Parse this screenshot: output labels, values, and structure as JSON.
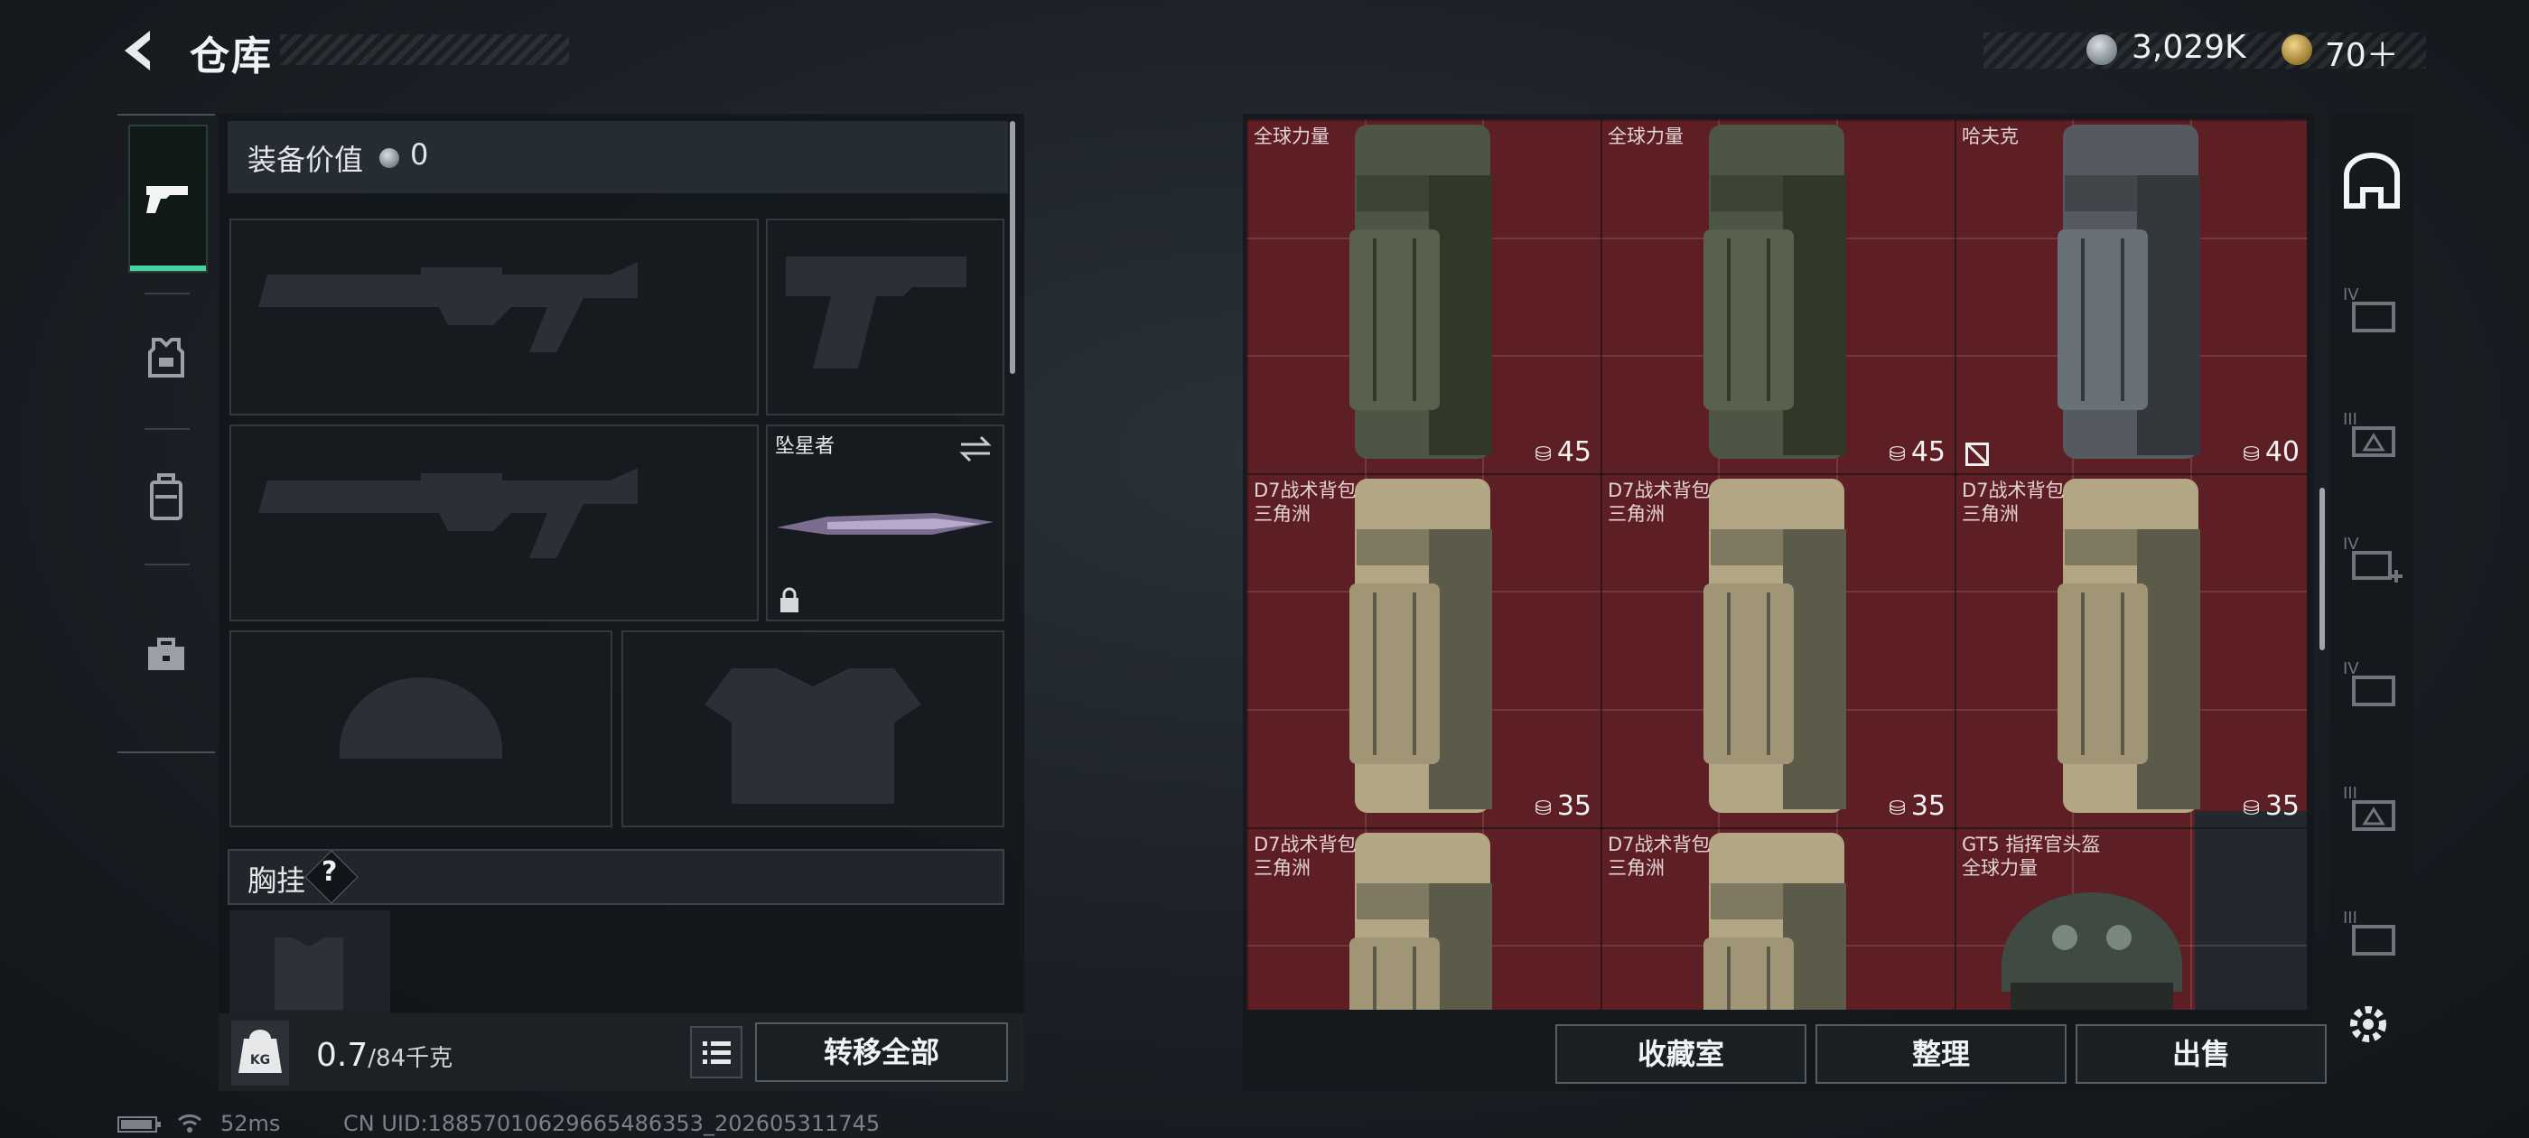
{
  "header": {
    "title": "仓库"
  },
  "currency": {
    "silver": "3,029K",
    "gold": "70＋"
  },
  "loadout": {
    "equipment_value_label": "装备价值",
    "equipment_value": "0",
    "melee_name": "坠星者",
    "chest_rig_label": "胸挂",
    "help_mark": "?"
  },
  "bottom": {
    "weight_value": "0.7",
    "weight_limit": "/84千克",
    "kg_label": "KG",
    "transfer_all": "转移全部",
    "collection": "收藏室",
    "sort": "整理",
    "sell": "出售"
  },
  "grid": {
    "items": [
      {
        "line1": "全球力量",
        "line2": "",
        "capacity": "45",
        "color": "olive"
      },
      {
        "line1": "全球力量",
        "line2": "",
        "capacity": "45",
        "color": "olive"
      },
      {
        "line1": "哈夫克",
        "line2": "",
        "capacity": "40",
        "color": "grey",
        "no_trade": true
      },
      {
        "line1": "D7战术背包",
        "line2": "三角洲",
        "capacity": "35",
        "color": "tan"
      },
      {
        "line1": "D7战术背包",
        "line2": "三角洲",
        "capacity": "35",
        "color": "tan"
      },
      {
        "line1": "D7战术背包",
        "line2": "三角洲",
        "capacity": "35",
        "color": "tan"
      },
      {
        "line1": "D7战术背包",
        "line2": "三角洲",
        "capacity": "",
        "color": "tan"
      },
      {
        "line1": "D7战术背包",
        "line2": "三角洲",
        "capacity": "",
        "color": "tan"
      },
      {
        "line1": "GT5 指挥官头盔",
        "line2": "全球力量",
        "capacity": "",
        "color": "helmet"
      }
    ]
  },
  "filters": [
    "all",
    "IV",
    "III",
    "IV",
    "IV",
    "III",
    "III"
  ],
  "status": {
    "ping": "52ms",
    "uid": "CN UID:18857010629665486353_202605311745"
  },
  "colors": {
    "accent": "#4ad0a2",
    "grid_bg": "#5e1f24"
  }
}
